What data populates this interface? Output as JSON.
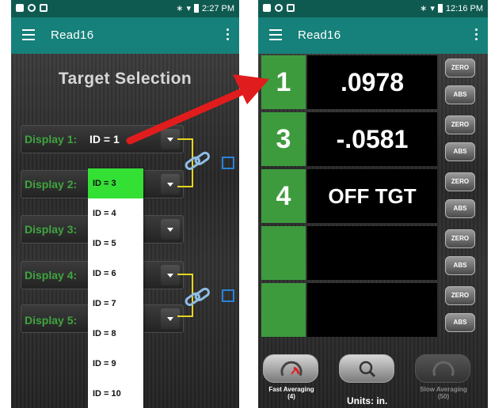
{
  "left": {
    "status": {
      "time": "2:27 PM"
    },
    "app_title": "Read16",
    "heading": "Target Selection",
    "displays": [
      {
        "label": "Display 1:",
        "value": "ID = 1"
      },
      {
        "label": "Display 2:",
        "value": ""
      },
      {
        "label": "Display 3:",
        "value": ""
      },
      {
        "label": "Display 4:",
        "value": ""
      },
      {
        "label": "Display 5:",
        "value": ""
      }
    ],
    "dropdown_options": [
      "ID = 3",
      "ID = 4",
      "ID = 5",
      "ID = 6",
      "ID = 7",
      "ID = 8",
      "ID = 9",
      "ID = 10"
    ],
    "dropdown_selected": "ID = 3"
  },
  "right": {
    "status": {
      "time": "12:16 PM"
    },
    "app_title": "Read16",
    "rows": [
      {
        "num": "1",
        "value": ".0978"
      },
      {
        "num": "3",
        "value": "-.0581"
      },
      {
        "num": "4",
        "value": "OFF TGT"
      },
      {
        "num": "",
        "value": ""
      },
      {
        "num": "",
        "value": ""
      }
    ],
    "zero_label": "ZERO",
    "abs_label": "ABS",
    "bottom": {
      "fast_label": "Fast Averaging",
      "fast_count": "(4)",
      "slow_label": "Slow Averaging",
      "slow_count": "(50)",
      "units": "Units: in."
    }
  },
  "colors": {
    "appbar": "#16807a",
    "statusbar": "#0e5a50",
    "display_label_green": "#3fa53f",
    "cell_green": "#3d9b3d",
    "dropdown_selected": "#35e035",
    "bracket_yellow": "#e5d422",
    "sync_blue": "#2a83d8",
    "arrow_red": "#e01c1c"
  },
  "icons": [
    "menu-icon",
    "overflow-menu-icon",
    "link-chain-icon",
    "speedometer-icon",
    "search-icon",
    "dropdown-caret-icon"
  ]
}
